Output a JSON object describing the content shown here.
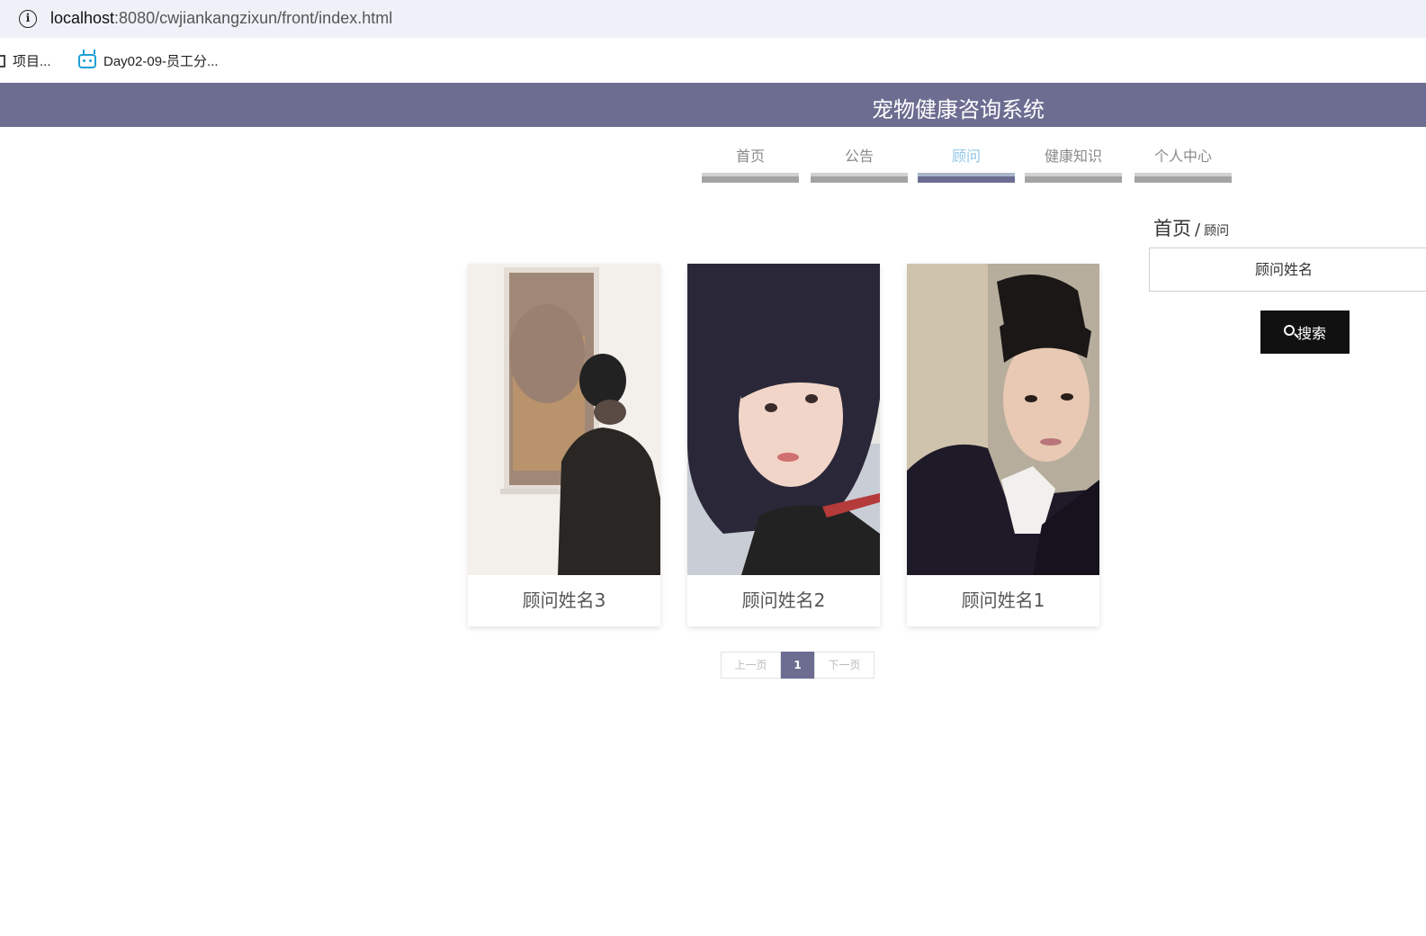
{
  "browser": {
    "url_host": "localhost",
    "url_rest": ":8080/cwjiankangzixun/front/index.html",
    "bookmarks": [
      {
        "label": "项目..."
      },
      {
        "label": "Day02-09-员工分..."
      }
    ]
  },
  "header": {
    "title": "宠物健康咨询系统"
  },
  "nav": {
    "items": [
      {
        "label": "首页"
      },
      {
        "label": "公告"
      },
      {
        "label": "顾问"
      },
      {
        "label": "健康知识"
      },
      {
        "label": "个人中心"
      }
    ],
    "active": "顾问"
  },
  "breadcrumb": {
    "home": "首页",
    "separator": "/",
    "current": "顾问"
  },
  "search": {
    "placeholder": "顾问姓名",
    "button_label": "搜索"
  },
  "consultants": [
    {
      "name": "顾问姓名3"
    },
    {
      "name": "顾问姓名2"
    },
    {
      "name": "顾问姓名1"
    }
  ],
  "pagination": {
    "prev_label": "上一页",
    "current_page": "1",
    "next_label": "下一页"
  },
  "colors": {
    "header": "#6c6d91",
    "active_nav_text": "#8fc6e6",
    "search_button": "#111111"
  }
}
